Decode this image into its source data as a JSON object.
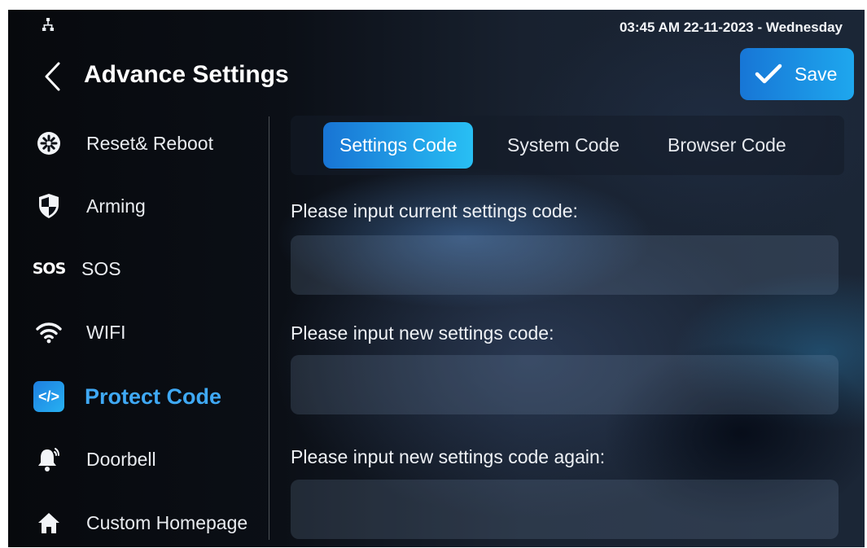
{
  "status_bar": {
    "network_icon": "ethernet-icon",
    "clock": "03:45 AM  22-11-2023 - Wednesday"
  },
  "header": {
    "title": "Advance Settings",
    "back_icon": "chevron-left-icon",
    "save_label": "Save",
    "save_icon": "checkmark-icon"
  },
  "sidebar": {
    "items": [
      {
        "label": "Reset& Reboot",
        "icon": "reset-icon",
        "active": false
      },
      {
        "label": "Arming",
        "icon": "shield-icon",
        "active": false
      },
      {
        "label": "SOS",
        "icon": "sos-icon",
        "icon_text": "SOS",
        "active": false
      },
      {
        "label": "WIFI",
        "icon": "wifi-icon",
        "active": false
      },
      {
        "label": "Protect Code",
        "icon": "code-icon",
        "icon_text": "</>",
        "active": true
      },
      {
        "label": "Doorbell",
        "icon": "bell-icon",
        "active": false
      },
      {
        "label": "Custom Homepage",
        "icon": "home-icon",
        "active": false
      }
    ]
  },
  "tabs": [
    {
      "label": "Settings Code",
      "active": true
    },
    {
      "label": "System Code",
      "active": false
    },
    {
      "label": "Browser Code",
      "active": false
    }
  ],
  "form": {
    "current_label": "Please input current settings code:",
    "current_value": "",
    "new_label": "Please input new settings code:",
    "new_value": "",
    "confirm_label": "Please input new settings code again:",
    "confirm_value": ""
  },
  "colors": {
    "accent": "#1ea7ee",
    "active_text": "#3fa9f5",
    "background": "#0b0f16"
  }
}
